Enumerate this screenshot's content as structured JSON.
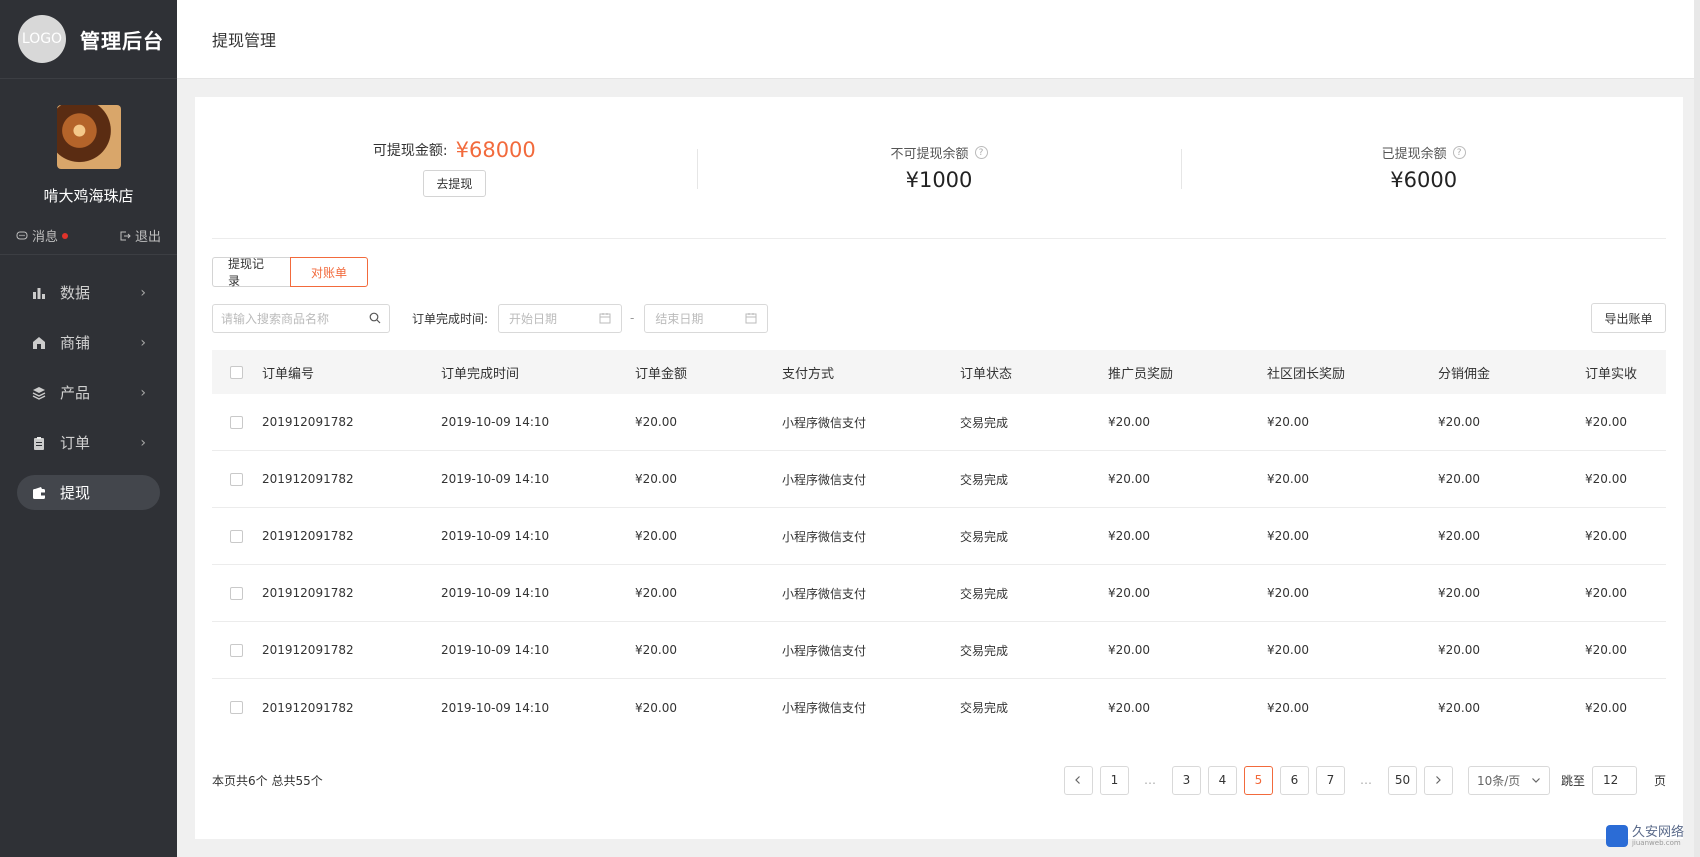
{
  "sidebar": {
    "logo_text": "LOGO",
    "brand_title": "管理后台",
    "shop_name": "啃大鸡海珠店",
    "messages_label": "消息",
    "logout_label": "退出",
    "items": [
      {
        "label": "数据",
        "icon": "bar-chart-icon"
      },
      {
        "label": "商铺",
        "icon": "shop-icon"
      },
      {
        "label": "产品",
        "icon": "layers-icon"
      },
      {
        "label": "订单",
        "icon": "clipboard-icon"
      },
      {
        "label": "提现",
        "icon": "wallet-icon",
        "active": true
      }
    ]
  },
  "header": {
    "title": "提现管理"
  },
  "stats": {
    "available_label": "可提现金额:",
    "available_amount": "¥68000",
    "withdraw_button": "去提现",
    "unavailable_label": "不可提现余额",
    "unavailable_amount": "¥1000",
    "withdrawn_label": "已提现余额",
    "withdrawn_amount": "¥6000",
    "help_glyph": "?"
  },
  "tabs": [
    {
      "label": "提现记录",
      "active": false
    },
    {
      "label": "对账单",
      "active": true
    }
  ],
  "filters": {
    "search_placeholder": "请输入搜索商品名称",
    "time_label": "订单完成时间:",
    "start_placeholder": "开始日期",
    "range_sep": "-",
    "end_placeholder": "结束日期",
    "export_button": "导出账单"
  },
  "table": {
    "columns": [
      "订单编号",
      "订单完成时间",
      "订单金额",
      "支付方式",
      "订单状态",
      "推广员奖励",
      "社区团长奖励",
      "分销佣金",
      "订单实收"
    ],
    "rows": [
      [
        "201912091782",
        "2019-10-09 14:10",
        "¥20.00",
        "小程序微信支付",
        "交易完成",
        "¥20.00",
        "¥20.00",
        "¥20.00",
        "¥20.00"
      ],
      [
        "201912091782",
        "2019-10-09 14:10",
        "¥20.00",
        "小程序微信支付",
        "交易完成",
        "¥20.00",
        "¥20.00",
        "¥20.00",
        "¥20.00"
      ],
      [
        "201912091782",
        "2019-10-09 14:10",
        "¥20.00",
        "小程序微信支付",
        "交易完成",
        "¥20.00",
        "¥20.00",
        "¥20.00",
        "¥20.00"
      ],
      [
        "201912091782",
        "2019-10-09 14:10",
        "¥20.00",
        "小程序微信支付",
        "交易完成",
        "¥20.00",
        "¥20.00",
        "¥20.00",
        "¥20.00"
      ],
      [
        "201912091782",
        "2019-10-09 14:10",
        "¥20.00",
        "小程序微信支付",
        "交易完成",
        "¥20.00",
        "¥20.00",
        "¥20.00",
        "¥20.00"
      ],
      [
        "201912091782",
        "2019-10-09 14:10",
        "¥20.00",
        "小程序微信支付",
        "交易完成",
        "¥20.00",
        "¥20.00",
        "¥20.00",
        "¥20.00"
      ]
    ]
  },
  "pagination": {
    "info": "本页共6个  总共55个",
    "pages": [
      "1",
      "…",
      "3",
      "4",
      "5",
      "6",
      "7",
      "…",
      "50"
    ],
    "current": "5",
    "page_size": "10条/页",
    "jump_label": "跳至",
    "jump_value": "12",
    "jump_suffix": "页"
  },
  "watermark": {
    "title": "久安网络",
    "sub": "jiuanweb.com"
  },
  "colors": {
    "accent": "#f26a3c",
    "sidebar_bg": "#2f3136"
  }
}
